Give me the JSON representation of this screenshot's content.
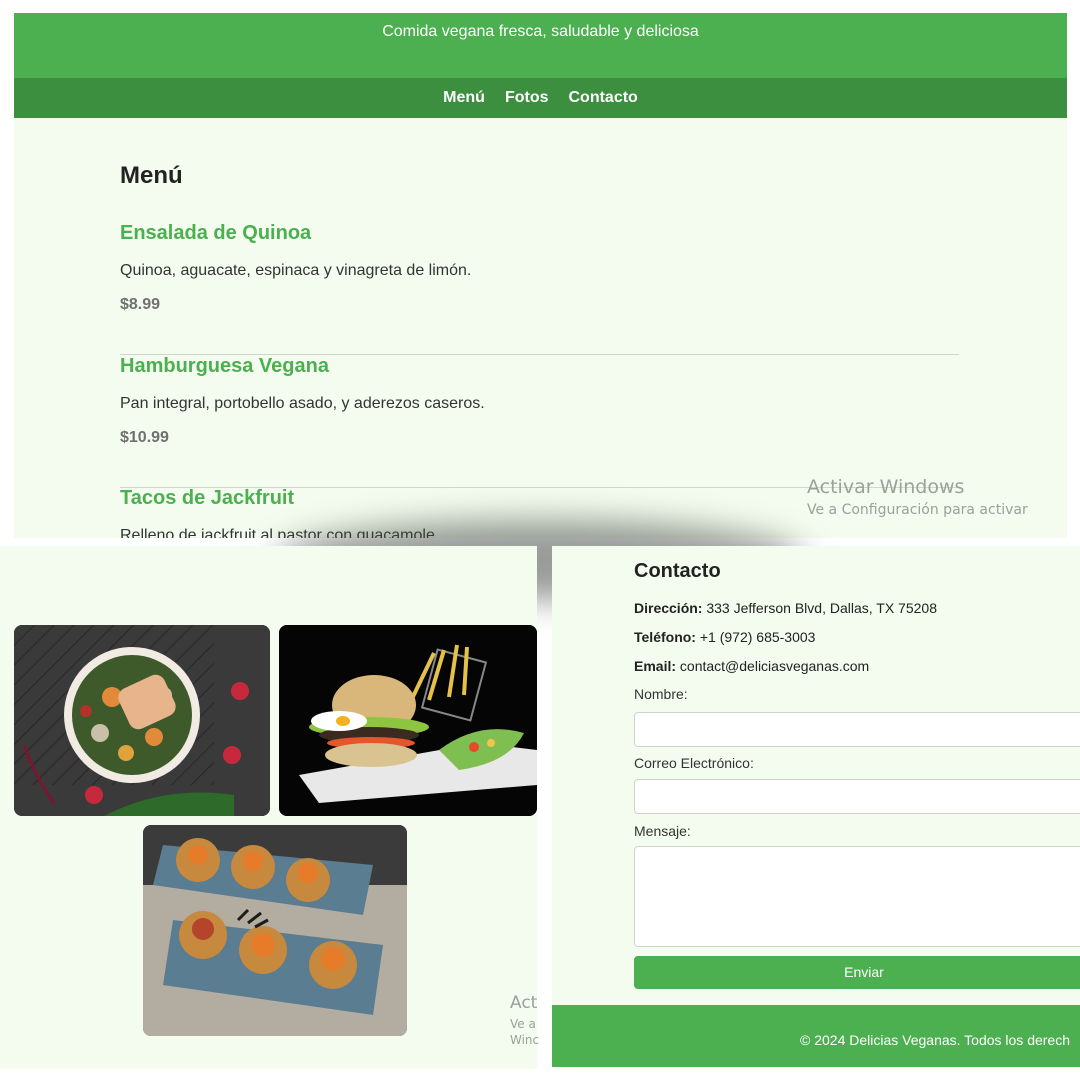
{
  "header": {
    "tagline": "Comida vegana fresca, saludable y deliciosa"
  },
  "nav": {
    "items": [
      "Menú",
      "Fotos",
      "Contacto"
    ]
  },
  "menu": {
    "title": "Menú",
    "items": [
      {
        "name": "Ensalada de Quinoa",
        "description": "Quinoa, aguacate, espinaca y vinagreta de limón.",
        "price": "$8.99"
      },
      {
        "name": "Hamburguesa Vegana",
        "description": "Pan integral, portobello asado, y aderezos caseros.",
        "price": "$10.99"
      },
      {
        "name": "Tacos de Jackfruit",
        "description": "Relleno de jackfruit al pastor con guacamole.",
        "price": ""
      }
    ]
  },
  "watermark": {
    "title": "Activar Windows",
    "subtitle": "Ve a Configuración para activar",
    "partial_title": "Act",
    "partial_line1": "Ve a",
    "partial_line2": "Winc"
  },
  "photos": {
    "items": [
      {
        "icon": "salad-bowl-photo"
      },
      {
        "icon": "vegan-burger-photo"
      },
      {
        "icon": "tacos-photo"
      }
    ]
  },
  "contact": {
    "title": "Contacto",
    "address_label": "Dirección:",
    "address_value": "333 Jefferson Blvd, Dallas, TX 75208",
    "phone_label": "Teléfono:",
    "phone_value": "+1 (972) 685-3003",
    "email_label": "Email:",
    "email_value": "contact@deliciasveganas.com",
    "form": {
      "name_label": "Nombre:",
      "email_label": "Correo Electrónico:",
      "message_label": "Mensaje:",
      "submit_label": "Enviar"
    }
  },
  "footer": {
    "text": "© 2024 Delicias Veganas. Todos los derech"
  },
  "colors": {
    "accent": "#4caf50",
    "nav": "#3d8f40",
    "background": "#f4fcef"
  }
}
